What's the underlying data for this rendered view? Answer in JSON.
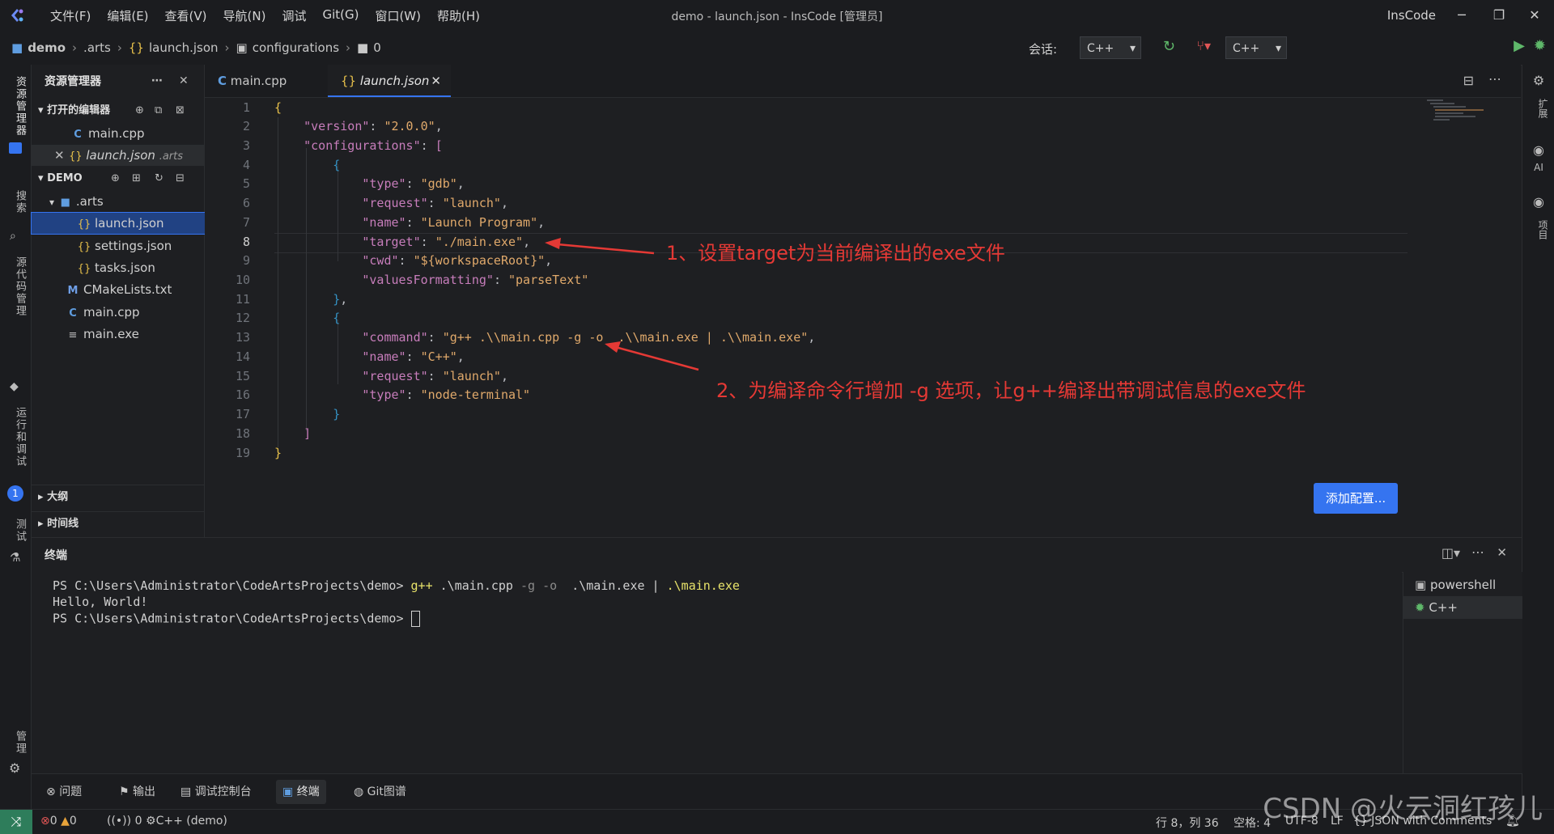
{
  "window": {
    "title": "demo - launch.json - InsCode [管理员]",
    "brand": "InsCode",
    "menu": [
      "文件(F)",
      "编辑(E)",
      "查看(V)",
      "导航(N)",
      "调试",
      "Git(G)",
      "窗口(W)",
      "帮助(H)"
    ]
  },
  "breadcrumb": {
    "items": [
      "demo",
      ".arts",
      "launch.json",
      "configurations",
      "0"
    ]
  },
  "toolbar": {
    "session_label": "会话:",
    "session_value": "C++",
    "config_value": "C++"
  },
  "activity": {
    "items": [
      "资源管理器",
      "搜索",
      "源代码管理",
      "运行和调试",
      "测试",
      "管理"
    ],
    "run_badge": "1"
  },
  "sidebar": {
    "title": "资源管理器",
    "open_editors_label": "打开的编辑器",
    "open_editors": [
      {
        "name": "main.cpp",
        "desc": ""
      },
      {
        "name": "launch.json",
        "desc": ".arts"
      }
    ],
    "project_label": "DEMO",
    "tree": [
      {
        "name": ".arts",
        "type": "folder"
      },
      {
        "name": "launch.json",
        "type": "json"
      },
      {
        "name": "settings.json",
        "type": "json"
      },
      {
        "name": "tasks.json",
        "type": "json"
      },
      {
        "name": "CMakeLists.txt",
        "type": "cmake"
      },
      {
        "name": "main.cpp",
        "type": "cpp"
      },
      {
        "name": "main.exe",
        "type": "file"
      }
    ],
    "outline_label": "大纲",
    "timeline_label": "时间线"
  },
  "tabs": [
    {
      "label": "main.cpp"
    },
    {
      "label": "launch.json"
    }
  ],
  "editor": {
    "line_numbers": [
      "1",
      "2",
      "3",
      "4",
      "5",
      "6",
      "7",
      "8",
      "9",
      "10",
      "11",
      "12",
      "13",
      "14",
      "15",
      "16",
      "17",
      "18",
      "19"
    ],
    "current_line": "8",
    "lines": {
      "l2_key": "\"version\"",
      "l2_val": "\"2.0.0\"",
      "l3_key": "\"configurations\"",
      "l5_key": "\"type\"",
      "l5_val": "\"gdb\"",
      "l6_key": "\"request\"",
      "l6_val": "\"launch\"",
      "l7_key": "\"name\"",
      "l7_val": "\"Launch Program\"",
      "l8_key": "\"target\"",
      "l8_val": "\"./main.exe\"",
      "l9_key": "\"cwd\"",
      "l9_val": "\"${workspaceRoot}\"",
      "l10_key": "\"valuesFormatting\"",
      "l10_val": "\"parseText\"",
      "l13_key": "\"command\"",
      "l13_val": "\"g++ .\\\\main.cpp -g -o  .\\\\main.exe | .\\\\main.exe\"",
      "l14_key": "\"name\"",
      "l14_val": "\"C++\"",
      "l15_key": "\"request\"",
      "l15_val": "\"launch\"",
      "l16_key": "\"type\"",
      "l16_val": "\"node-terminal\""
    },
    "annotation1": "1、设置target为当前编译出的exe文件",
    "annotation2": "2、为编译命令行增加 -g 选项，让g++编译出带调试信息的exe文件",
    "add_config_button": "添加配置..."
  },
  "rightbar": {
    "items": [
      "扩展",
      "AI",
      "项目"
    ]
  },
  "panel": {
    "title": "终端",
    "terminal_lines": {
      "prompt1": "PS C:\\Users\\Administrator\\CodeArtsProjects\\demo> ",
      "cmd_gpp": "g++",
      "cmd_rest1": " .\\main.cpp ",
      "cmd_flags": "-g -o",
      "cmd_rest2": "  .\\main.exe | ",
      "cmd_exe": ".\\main.exe",
      "output": "Hello, World!",
      "prompt2": "PS C:\\Users\\Administrator\\CodeArtsProjects\\demo> "
    },
    "terminals": [
      "powershell",
      "C++"
    ],
    "tabs": [
      "问题",
      "输出",
      "调试控制台",
      "终端",
      "Git图谱"
    ]
  },
  "status": {
    "errors": "0",
    "warnings": "0",
    "ports": "0",
    "session": "C++ (demo)",
    "position": "行 8，列 36",
    "indent": "空格: 4",
    "encoding": "UTF-8",
    "eol": "LF",
    "language": "JSON with Comments"
  },
  "watermark": "CSDN @火云洞红孩儿",
  "colors": {
    "accent": "#3574f0",
    "annotation": "#e53935",
    "json_key": "#c77dbb",
    "json_string": "#e0a96b"
  }
}
